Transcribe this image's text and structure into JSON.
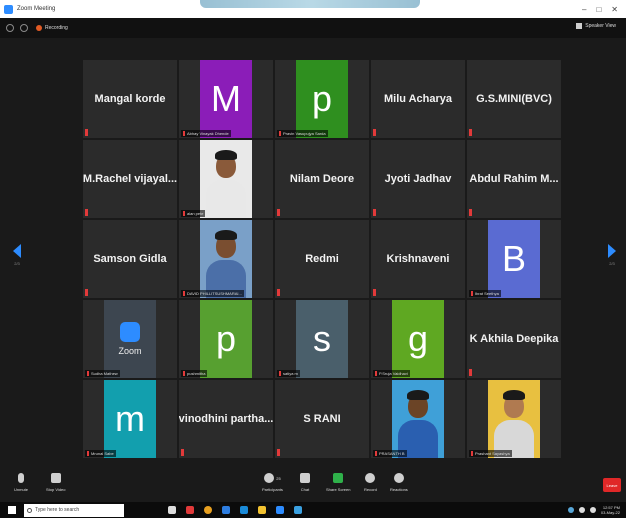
{
  "window": {
    "title": "Zoom Meeting"
  },
  "header": {
    "recording_label": "Recording",
    "speaker_view_label": "Speaker View"
  },
  "tiles": [
    {
      "name": "Mangal korde"
    },
    {
      "initial": "M",
      "tag": "Abhay Vinayak Dhende",
      "color": "#8b1db8"
    },
    {
      "initial": "p",
      "tag": "Pravin Vasupujya Sarda",
      "color": "#2f8f1f"
    },
    {
      "name": "Milu Acharya"
    },
    {
      "name": "G.S.MINI(BVC)"
    },
    {
      "name": "M.Rachel vijayal..."
    },
    {
      "photo": true,
      "tag": "alan pete",
      "skin": "#8a5a3a",
      "shirt": "#e8e8e8",
      "bg": "#e9e9e9"
    },
    {
      "name": "Nilam Deore"
    },
    {
      "name": "Jyoti Jadhav"
    },
    {
      "name": "Abdul Rahim M..."
    },
    {
      "name": "Samson Gidla"
    },
    {
      "photo": true,
      "tag": "DAVID PHILLITSUSHMARAI...",
      "skin": "#7a4e30",
      "shirt": "#4b6fa8",
      "bg": "#7aa0c8"
    },
    {
      "name": "Redmi"
    },
    {
      "name": "Krishnaveni"
    },
    {
      "initial": "B",
      "tag": "Ibrat Seethya",
      "color": "#5a6bd2"
    },
    {
      "zoom": true,
      "label": "Zoom",
      "tag": "Sudha Mathew"
    },
    {
      "initial": "p",
      "tag": "pushmitha",
      "color": "#57a030"
    },
    {
      "initial": "s",
      "tag": "satiya m",
      "color": "#4a5f6b"
    },
    {
      "initial": "g",
      "tag": "P.Sruja Vaidhavi",
      "color": "#5fa822"
    },
    {
      "name": "K Akhila Deepika"
    },
    {
      "initial": "m",
      "tag": "Mrunal Sabe",
      "color": "#129fae"
    },
    {
      "name": "vinodhini partha..."
    },
    {
      "name": "S RANI"
    },
    {
      "photo": true,
      "tag": "PRASANTH B",
      "skin": "#6b4426",
      "shirt": "#2a5fb0",
      "bg": "#3fa0d8"
    },
    {
      "photo": true,
      "tag": "Prashant Sayashya",
      "skin": "#b07a50",
      "shirt": "#d8d8d8",
      "bg": "#e8c040"
    }
  ],
  "nav": {
    "page_left": "2/3",
    "page_right": "2/3"
  },
  "controls": {
    "unmute": "Unmute",
    "stop_video": "Stop Video",
    "participants": "Participants",
    "participants_count": "25",
    "chat": "Chat",
    "share_screen": "Share Screen",
    "record": "Record",
    "reactions": "Reactions",
    "leave": "Leave"
  },
  "taskbar": {
    "search_placeholder": "Type here to search",
    "time": "12:57 PM",
    "date": "03-May-22"
  }
}
